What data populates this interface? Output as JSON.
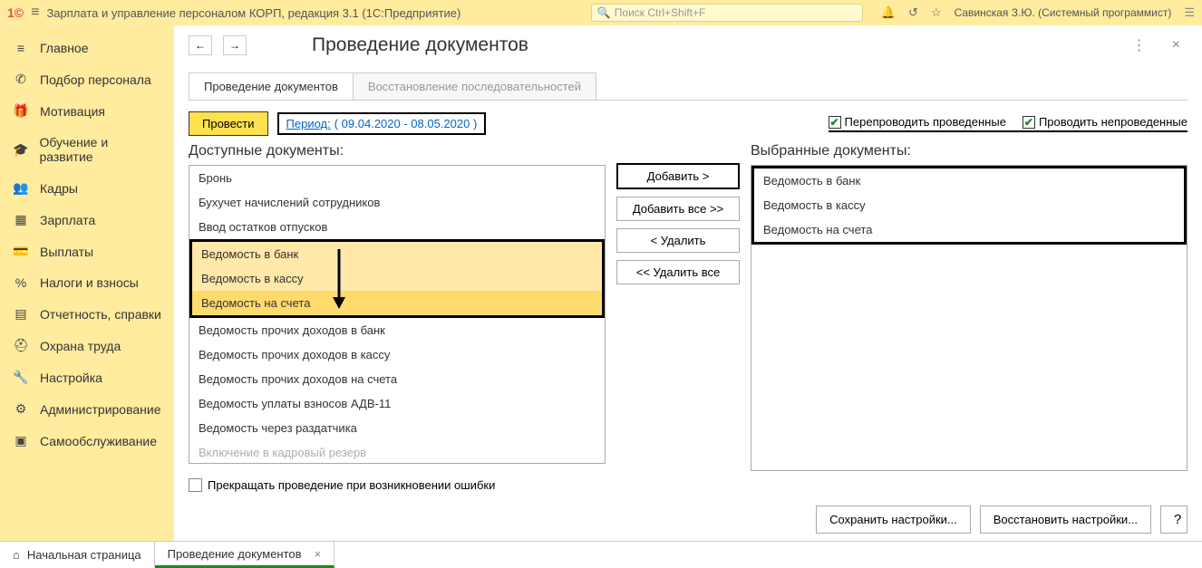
{
  "app": {
    "title": "Зарплата и управление персоналом КОРП, редакция 3.1  (1С:Предприятие)",
    "search_placeholder": "Поиск Ctrl+Shift+F",
    "username": "Савинская З.Ю. (Системный программист)"
  },
  "sidebar": {
    "items": [
      {
        "icon": "≡",
        "label": "Главное"
      },
      {
        "icon": "✆",
        "label": "Подбор персонала"
      },
      {
        "icon": "🎁",
        "label": "Мотивация"
      },
      {
        "icon": "🎓",
        "label": "Обучение и развитие"
      },
      {
        "icon": "👥",
        "label": "Кадры"
      },
      {
        "icon": "▦",
        "label": "Зарплата"
      },
      {
        "icon": "💳",
        "label": "Выплаты"
      },
      {
        "icon": "%",
        "label": "Налоги и взносы"
      },
      {
        "icon": "▤",
        "label": "Отчетность, справки"
      },
      {
        "icon": "⛑",
        "label": "Охрана труда"
      },
      {
        "icon": "🔧",
        "label": "Настройка"
      },
      {
        "icon": "⚙",
        "label": "Администрирование"
      },
      {
        "icon": "▣",
        "label": "Самообслуживание"
      }
    ]
  },
  "page": {
    "title": "Проведение документов"
  },
  "tabs": [
    {
      "label": "Проведение документов",
      "active": true
    },
    {
      "label": "Восстановление последовательностей",
      "active": false
    }
  ],
  "actions": {
    "run": "Провести",
    "period_label": "Период:",
    "period_range": "( 09.04.2020 - 08.05.2020 )"
  },
  "checks": {
    "repost": "Перепроводить проведенные",
    "post_unposted": "Проводить непроведенные"
  },
  "left_panel": {
    "title": "Доступные документы:",
    "items": [
      "Бронь",
      "Бухучет начислений сотрудников",
      "Ввод остатков отпусков",
      "Ведомость в банк",
      "Ведомость в кассу",
      "Ведомость на счета",
      "Ведомость прочих доходов в банк",
      "Ведомость прочих доходов в кассу",
      "Ведомость прочих доходов на счета",
      "Ведомость уплаты взносов АДВ-11",
      "Ведомость через раздатчика",
      "Включение в кадровый резерв"
    ]
  },
  "mid_buttons": {
    "add": "Добавить >",
    "add_all": "Добавить все >>",
    "remove": "< Удалить",
    "remove_all": "<< Удалить все"
  },
  "right_panel": {
    "title": "Выбранные документы:",
    "items": [
      "Ведомость в банк",
      "Ведомость в кассу",
      "Ведомость на счета"
    ]
  },
  "stop_on_error": "Прекращать проведение при возникновении ошибки",
  "bottom": {
    "save": "Сохранить настройки...",
    "restore": "Восстановить настройки...",
    "help": "?"
  },
  "taskbar": {
    "home": "Начальная страница",
    "current": "Проведение документов"
  }
}
